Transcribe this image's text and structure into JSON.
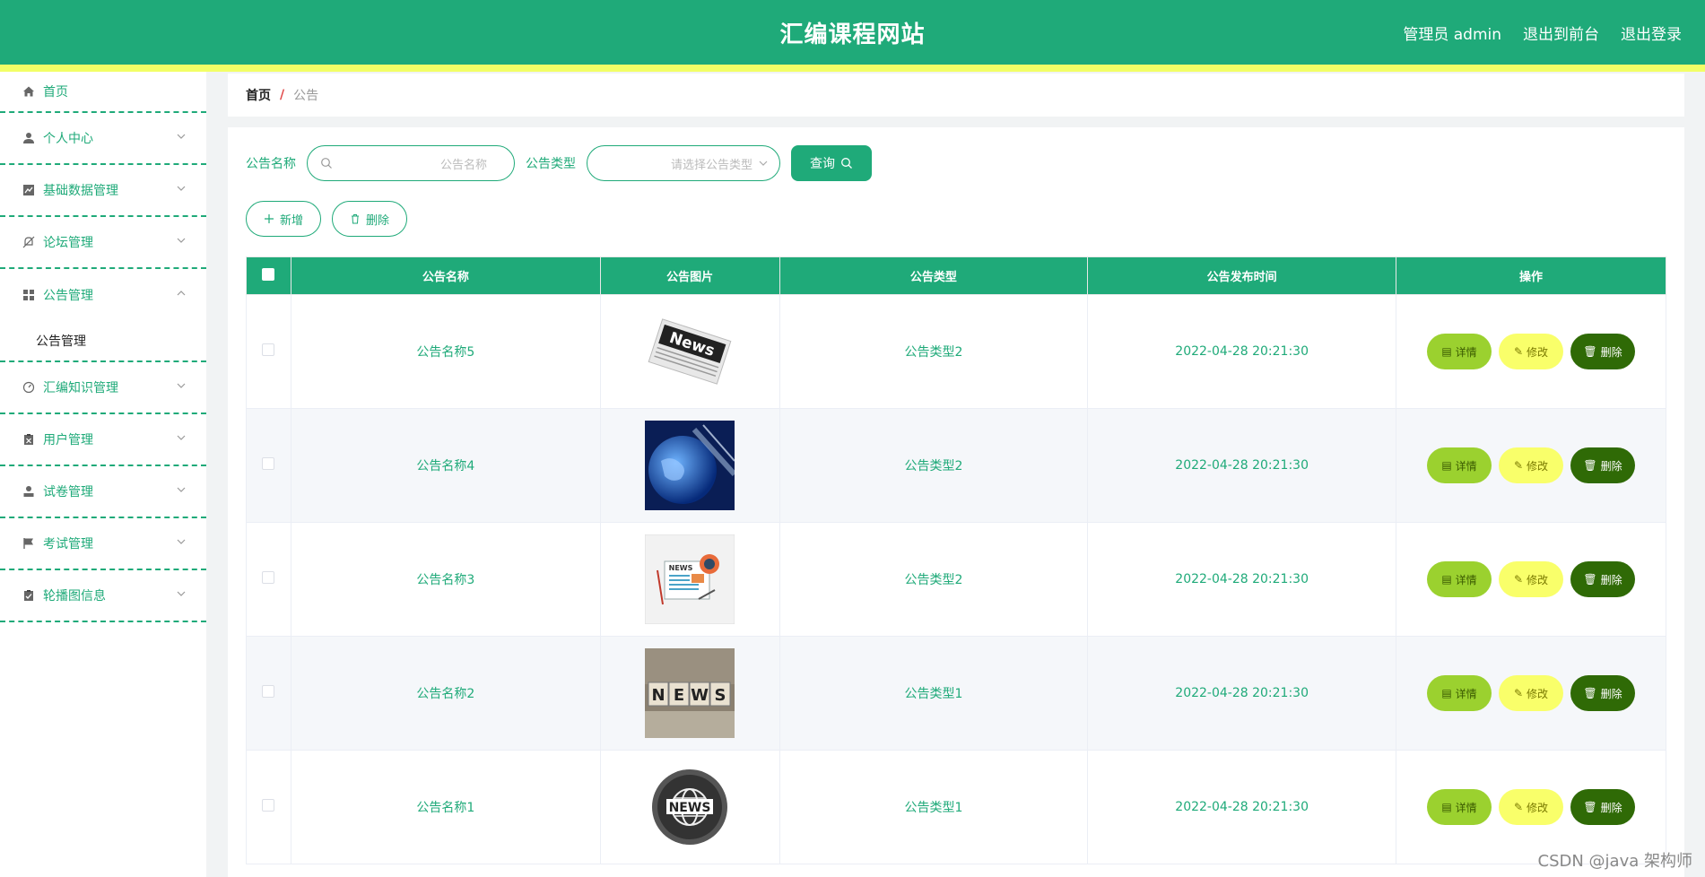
{
  "header": {
    "title": "汇编课程网站",
    "admin": "管理员 admin",
    "to_front": "退出到前台",
    "logout": "退出登录",
    "colors": {
      "primary": "#1faa79",
      "strip": "#f2ff66"
    }
  },
  "sidebar": {
    "items": [
      {
        "label": "首页",
        "icon": "home-icon"
      },
      {
        "label": "个人中心",
        "icon": "user-icon"
      },
      {
        "label": "基础数据管理",
        "icon": "chart-icon"
      },
      {
        "label": "论坛管理",
        "icon": "bell-off-icon"
      },
      {
        "label": "公告管理",
        "icon": "grid-icon",
        "open": true,
        "sub": [
          "公告管理"
        ]
      },
      {
        "label": "汇编知识管理",
        "icon": "gauge-icon"
      },
      {
        "label": "用户管理",
        "icon": "clipboard-icon"
      },
      {
        "label": "试卷管理",
        "icon": "person-icon"
      },
      {
        "label": "考试管理",
        "icon": "flag-icon"
      },
      {
        "label": "轮播图信息",
        "icon": "checklist-icon"
      }
    ]
  },
  "breadcrumb": {
    "home": "首页",
    "sep": "/",
    "current": "公告"
  },
  "search": {
    "name_label": "公告名称",
    "name_placeholder": "公告名称",
    "type_label": "公告类型",
    "type_placeholder": "请选择公告类型",
    "query_label": "查询"
  },
  "actions": {
    "add": "新增",
    "delete": "删除"
  },
  "table": {
    "columns": [
      "公告名称",
      "公告图片",
      "公告类型",
      "公告发布时间",
      "操作"
    ],
    "rows": [
      {
        "name": "公告名称5",
        "type": "公告类型2",
        "time": "2022-04-28 20:21:30",
        "image": "newspaper-news-image"
      },
      {
        "name": "公告名称4",
        "type": "公告类型2",
        "time": "2022-04-28 20:21:30",
        "image": "globe-blue-image"
      },
      {
        "name": "公告名称3",
        "type": "公告类型2",
        "time": "2022-04-28 20:21:30",
        "image": "news-illustration-image"
      },
      {
        "name": "公告名称2",
        "type": "公告类型1",
        "time": "2022-04-28 20:21:30",
        "image": "news-blocks-image"
      },
      {
        "name": "公告名称1",
        "type": "公告类型1",
        "time": "2022-04-28 20:21:30",
        "image": "news-globe-badge-image"
      }
    ],
    "ops": {
      "detail": "详情",
      "edit": "修改",
      "delete": "删除"
    }
  },
  "watermark": "CSDN @java 架构师"
}
